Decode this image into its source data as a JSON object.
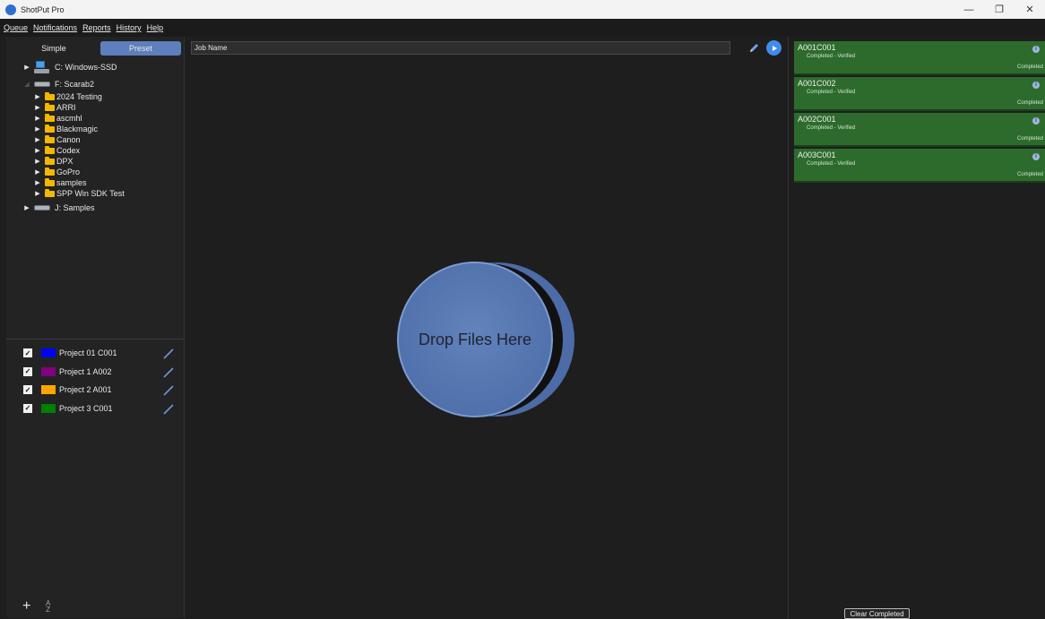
{
  "window": {
    "title": "ShotPut Pro",
    "controls": {
      "minimize": "—",
      "restore": "❐",
      "close": "✕"
    }
  },
  "menu": [
    "Queue",
    "Notifications",
    "Reports",
    "History",
    "Help"
  ],
  "left": {
    "mode_simple": "Simple",
    "mode_preset": "Preset",
    "tree": [
      {
        "label": "C: Windows-SSD",
        "type": "pc"
      },
      {
        "label": "F: Scarab2",
        "type": "drive",
        "expanded": true
      },
      {
        "label": "2024 Testing",
        "type": "folder"
      },
      {
        "label": "ARRI",
        "type": "folder"
      },
      {
        "label": "ascmhl",
        "type": "folder"
      },
      {
        "label": "Blackmagic",
        "type": "folder"
      },
      {
        "label": "Canon",
        "type": "folder"
      },
      {
        "label": "Codex",
        "type": "folder"
      },
      {
        "label": "DPX",
        "type": "folder"
      },
      {
        "label": "GoPro",
        "type": "folder"
      },
      {
        "label": "samples",
        "type": "folder"
      },
      {
        "label": "SPP Win SDK Test",
        "type": "folder"
      },
      {
        "label": "J: Samples",
        "type": "drive"
      }
    ],
    "projects": [
      {
        "label": "Project 01 C001",
        "color": "#0000ff"
      },
      {
        "label": "Project 1 A002",
        "color": "#800080"
      },
      {
        "label": "Project 2 A001",
        "color": "#ffa500"
      },
      {
        "label": "Project 3 C001",
        "color": "#008000"
      }
    ],
    "footer": {
      "add": "+",
      "sort": "AZ"
    }
  },
  "center": {
    "job_name": "Job Name",
    "drop_label": "Drop Files Here"
  },
  "queue": {
    "items": [
      {
        "name": "A001C001",
        "status": "Completed - Verified",
        "state": "Completed"
      },
      {
        "name": "A001C002",
        "status": "Completed - Verified",
        "state": "Completed"
      },
      {
        "name": "A002C001",
        "status": "Completed - Verified",
        "state": "Completed"
      },
      {
        "name": "A003C001",
        "status": "Completed - Verified",
        "state": "Completed"
      }
    ],
    "clear_label": "Clear Completed"
  },
  "colors": {
    "accent": "#5d7fbd",
    "queue_complete": "#2d6b2d",
    "drop_zone": "#5878b2"
  }
}
